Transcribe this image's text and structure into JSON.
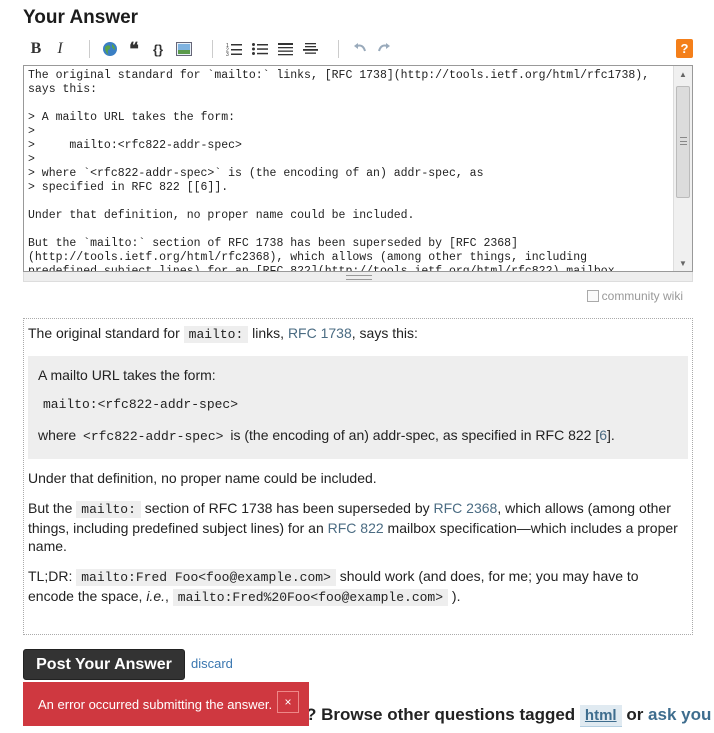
{
  "heading": "Your Answer",
  "toolbar": {
    "bold": "B",
    "italic": "I",
    "link": "🌐",
    "quote": "❝",
    "code": "{}",
    "help": "?"
  },
  "editor": {
    "text": "The original standard for `mailto:` links, [RFC 1738](http://tools.ietf.org/html/rfc1738),\nsays this:\n\n> A mailto URL takes the form:\n>\n>     mailto:<rfc822-addr-spec>\n>\n> where `<rfc822-addr-spec>` is (the encoding of an) addr-spec, as\n> specified in RFC 822 [[6]].\n\nUnder that definition, no proper name could be included.\n\nBut the `mailto:` section of RFC 1738 has been superseded by [RFC 2368]\n(http://tools.ietf.org/html/rfc2368), which allows (among other things, including\npredefined subject lines) for an [RFC 822](http://tools.ietf.org/html/rfc822) mailbox"
  },
  "community_wiki": "community wiki",
  "preview": {
    "p1_a": "The original standard for ",
    "p1_code": "mailto:",
    "p1_b": " links, ",
    "p1_link": "RFC 1738",
    "p1_c": ", says this:",
    "q1": "A mailto URL takes the form:",
    "q_pre": "mailto:<rfc822-addr-spec>",
    "q2_a": "where ",
    "q2_code": "<rfc822-addr-spec>",
    "q2_b": " is (the encoding of an) addr-spec, as specified in RFC 822 [",
    "q2_link": "6",
    "q2_c": "].",
    "p2": "Under that definition, no proper name could be included.",
    "p3_a": "But the ",
    "p3_code": "mailto:",
    "p3_b": " section of RFC 1738 has been superseded by ",
    "p3_link1": "RFC 2368",
    "p3_c": ", which allows (among other things, including predefined subject lines) for an ",
    "p3_link2": "RFC 822",
    "p3_d": " mailbox specification—which includes a proper name.",
    "p4_a": "TL;DR: ",
    "p4_code1": "mailto:Fred Foo<foo@example.com>",
    "p4_b": " should work (and does, for me; you may have to encode the space, ",
    "p4_ie": "i.e.",
    "p4_c": ", ",
    "p4_code2": "mailto:Fred%20Foo<foo@example.com>",
    "p4_d": " )."
  },
  "actions": {
    "post_label": "Post Your Answer",
    "discard_label": "discard"
  },
  "footer": {
    "text": "? Browse other questions tagged ",
    "tag": "html",
    "or": " or ",
    "ask": "ask you"
  },
  "toast": {
    "message": "An error occurred submitting the answer.",
    "close": "×"
  }
}
